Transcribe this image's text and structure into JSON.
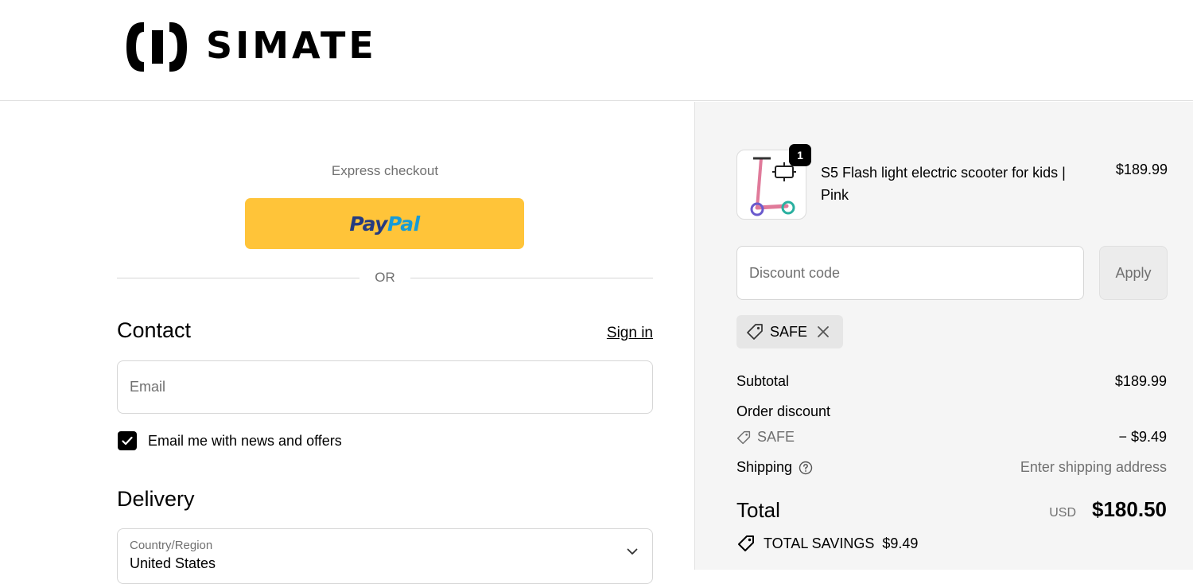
{
  "header": {
    "logo_text": "SIMATE"
  },
  "express": {
    "label": "Express checkout",
    "paypal_a": "Pay",
    "paypal_b": "Pal"
  },
  "divider": {
    "or_text": "OR"
  },
  "contact": {
    "title": "Contact",
    "sign_in": "Sign in",
    "email_placeholder": "Email",
    "newsletter_label": "Email me with news and offers",
    "newsletter_checked": true
  },
  "delivery": {
    "title": "Delivery",
    "country_label": "Country/Region",
    "country_value": "United States"
  },
  "summary": {
    "product": {
      "quantity": "1",
      "name": "S5 Flash light electric scooter for kids | Pink",
      "price": "$189.99"
    },
    "discount": {
      "placeholder": "Discount code",
      "apply_label": "Apply",
      "applied_code": "SAFE"
    },
    "subtotal_label": "Subtotal",
    "subtotal_value": "$189.99",
    "order_discount_label": "Order discount",
    "discount_code_label": "SAFE",
    "discount_value": "− $9.49",
    "shipping_label": "Shipping",
    "shipping_value": "Enter shipping address",
    "total_label": "Total",
    "total_currency": "USD",
    "total_value": "$180.50",
    "savings_label": "TOTAL SAVINGS",
    "savings_value": "$9.49"
  },
  "colors": {
    "paypal_yellow": "#ffc439",
    "right_panel_bg": "#f5f5f5",
    "muted_text": "#707070"
  }
}
